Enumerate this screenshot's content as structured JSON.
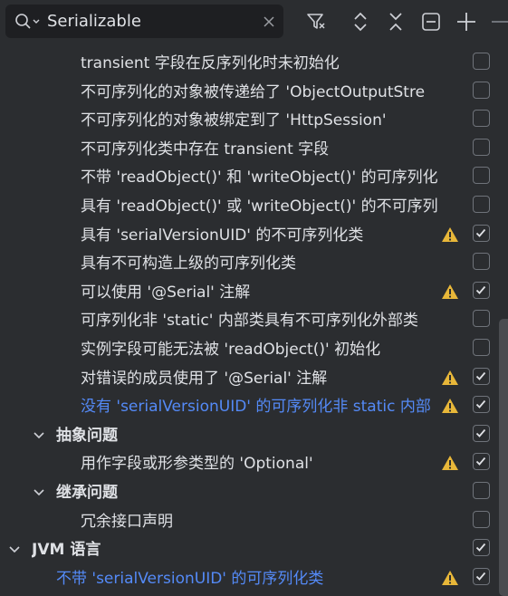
{
  "search": {
    "value": "Serializable",
    "icon": "search-icon",
    "clear_icon": "close-icon"
  },
  "toolbar": [
    {
      "name": "filter-icon"
    },
    {
      "name": "expand-all-icon"
    },
    {
      "name": "collapse-all-icon"
    },
    {
      "name": "minus-square-icon"
    },
    {
      "name": "plus-icon"
    }
  ],
  "colors": {
    "warning": "#e8b739",
    "link": "#548af7",
    "text": "#dfe1e5",
    "checkbox_border": "#6f737a"
  },
  "rows": [
    {
      "label": "transient 字段在反序列化时未初始化",
      "checked": false,
      "warning": false
    },
    {
      "label": "不可序列化的对象被传递给了 'ObjectOutputStre",
      "checked": false,
      "warning": false
    },
    {
      "label": "不可序列化的对象被绑定到了 'HttpSession'",
      "checked": false,
      "warning": false
    },
    {
      "label": "不可序列化类中存在 transient 字段",
      "checked": false,
      "warning": false
    },
    {
      "label": "不带 'readObject()' 和 'writeObject()' 的可序列化",
      "checked": false,
      "warning": false
    },
    {
      "label": "具有 'readObject()' 或 'writeObject()' 的不可序列",
      "checked": false,
      "warning": false
    },
    {
      "label": "具有 'serialVersionUID' 的不可序列化类",
      "checked": true,
      "warning": true
    },
    {
      "label": "具有不可构造上级的可序列化类",
      "checked": false,
      "warning": false
    },
    {
      "label": "可以使用 '@Serial' 注解",
      "checked": true,
      "warning": true
    },
    {
      "label": "可序列化非 'static' 内部类具有不可序列化外部类",
      "checked": false,
      "warning": false
    },
    {
      "label": "实例字段可能无法被 'readObject()' 初始化",
      "checked": false,
      "warning": false
    },
    {
      "label": "对错误的成员使用了 '@Serial' 注解",
      "checked": true,
      "warning": true
    },
    {
      "label": "没有 'serialVersionUID' 的可序列化非 static 内部",
      "checked": true,
      "warning": true,
      "link": true
    },
    {
      "label": "抽象问题",
      "checked": true,
      "warning": false,
      "group": true
    },
    {
      "label": "用作字段或形参类型的 'Optional'",
      "checked": true,
      "warning": true
    },
    {
      "label": "继承问题",
      "checked": false,
      "warning": false,
      "group": true
    },
    {
      "label": "冗余接口声明",
      "checked": false,
      "warning": false
    },
    {
      "label": "JVM 语言",
      "checked": true,
      "warning": false,
      "group": true,
      "top": true
    },
    {
      "label": "不带 'serialVersionUID' 的可序列化类",
      "checked": true,
      "warning": true,
      "link": true
    }
  ]
}
